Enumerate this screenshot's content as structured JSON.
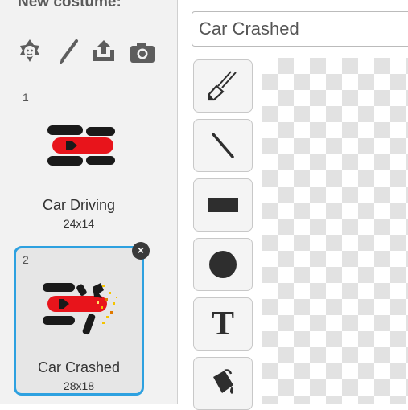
{
  "costume_panel": {
    "title": "New costume:",
    "tools": [
      {
        "icon": "sprite-library-icon",
        "tooltip": ""
      },
      {
        "icon": "paint-brush-icon",
        "tooltip": ""
      },
      {
        "icon": "upload-icon",
        "tooltip": ""
      },
      {
        "icon": "camera-icon",
        "tooltip": ""
      }
    ],
    "costumes": [
      {
        "number": "1",
        "name": "Car Driving",
        "size": "24x14",
        "selected": false
      },
      {
        "number": "2",
        "name": "Car Crashed",
        "size": "28x18",
        "selected": true
      }
    ],
    "delete_symbol": "×"
  },
  "editor": {
    "costume_name_value": "Car Crashed",
    "text_tool_glyph": "T",
    "tools": [
      "brush",
      "line",
      "rectangle",
      "ellipse",
      "text",
      "fill"
    ]
  },
  "colors": {
    "selection_border": "#2ea1e0",
    "car_body": "#e8141b",
    "wheels": "#1a1a1a"
  }
}
